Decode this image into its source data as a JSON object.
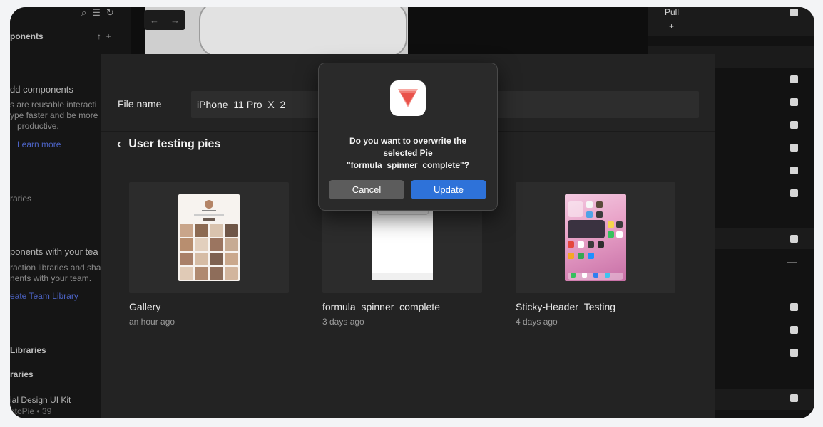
{
  "background_app": {
    "left_panel": {
      "components_header": "ponents",
      "add_components_title": "dd components",
      "description_lines": [
        "s are reusable interacti",
        "ype faster and be more",
        "productive."
      ],
      "learn_more": "Learn more",
      "libraries": "raries",
      "team_title": "ponents with your tea",
      "team_lines": [
        "raction libraries and sha",
        "nents with your team."
      ],
      "create_team_library": "eate Team Library",
      "libraries_header": "Libraries",
      "libraries_sub": "raries",
      "kit_name": "ial Design UI Kit",
      "kit_meta": "otoPie • 39"
    },
    "nav_arrows": [
      "←",
      "→"
    ],
    "right_panel": {
      "pull_label": "Pull",
      "add_symbol": "+"
    }
  },
  "save_dialog": {
    "file_name_label": "File name",
    "file_name_value": "iPhone_11 Pro_X_2",
    "folder_title": "User testing pies",
    "pies": [
      {
        "name": "Gallery",
        "date": "an hour ago"
      },
      {
        "name": "formula_spinner_complete",
        "date": "3 days ago"
      },
      {
        "name": "Sticky-Header_Testing",
        "date": "4 days ago"
      }
    ]
  },
  "modal": {
    "message_line1": "Do you want to overwrite the",
    "message_line2": "selected Pie",
    "message_line3": "\"formula_spinner_complete\"?",
    "cancel_label": "Cancel",
    "update_label": "Update",
    "colors": {
      "update": "#2e72d9",
      "cancel": "#5c5c5c",
      "icon_red": "#ef4f47"
    }
  },
  "icons": {
    "back": "chevron-left-icon",
    "app": "protopie-logo-icon"
  }
}
